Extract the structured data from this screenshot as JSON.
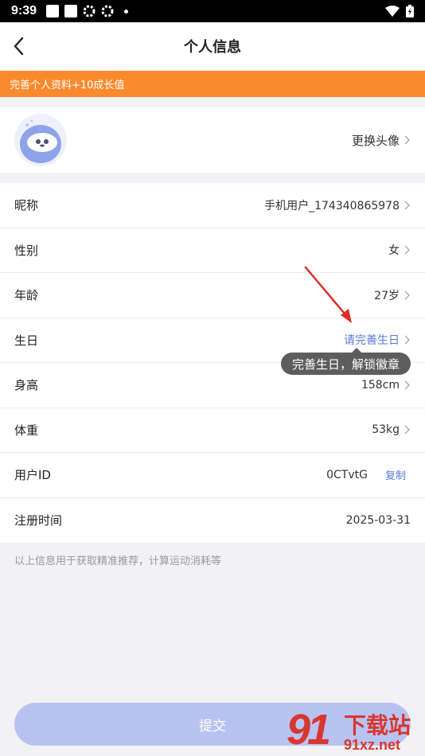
{
  "status_bar": {
    "time": "9:39"
  },
  "header": {
    "title": "个人信息"
  },
  "banner": {
    "text": "完善个人资料+10成长值"
  },
  "avatar_section": {
    "change_label": "更换头像"
  },
  "profile_rows": [
    {
      "label": "昵称",
      "value": "手机用户_174340865978"
    },
    {
      "label": "性别",
      "value": "女"
    },
    {
      "label": "年龄",
      "value": "27岁"
    },
    {
      "label": "生日",
      "value": "请完善生日"
    },
    {
      "label": "身高",
      "value": "158cm"
    },
    {
      "label": "体重",
      "value": "53kg"
    },
    {
      "label": "用户ID",
      "value": "0CTvtG",
      "action": "复制"
    },
    {
      "label": "注册时间",
      "value": "2025-03-31"
    }
  ],
  "tooltip": {
    "text": "完善生日，解锁徽章"
  },
  "note": "以上信息用于获取精准推荐，计算运动消耗等",
  "submit": {
    "label": "提交"
  },
  "watermark": {
    "number": "91",
    "text": "下载站",
    "url": "91xz.net"
  },
  "colors": {
    "accent": "#fb8a2e",
    "link": "#5a7bd8",
    "button": "#b8c3f2",
    "watermark": "#d8372f"
  }
}
